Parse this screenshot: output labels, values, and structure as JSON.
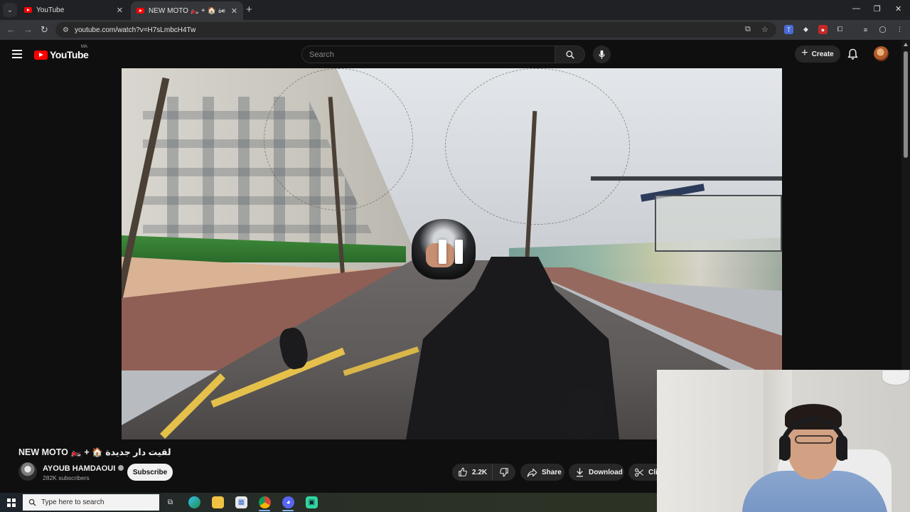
{
  "browser": {
    "tabs": [
      {
        "title": "YouTube",
        "active": false
      },
      {
        "title": "NEW MOTO 🏍️ + 🏠 لقيت دار جديدة",
        "active": true
      }
    ],
    "url": "youtube.com/watch?v=H7sLmbcH4Tw"
  },
  "masthead": {
    "logo_text": "YouTube",
    "region": "MA",
    "search_placeholder": "Search",
    "create_label": "Create"
  },
  "video": {
    "state": "paused-overlay"
  },
  "details": {
    "title": "NEW MOTO 🏍️ + 🏠 لقيت دار جديدة",
    "channel_name": "AYOUB HAMDAOUI",
    "subscribers": "282K subscribers",
    "subscribe_label": "Subscribe",
    "likes": "2.2K",
    "share_label": "Share",
    "download_label": "Download",
    "clip_label": "Clip"
  },
  "taskbar": {
    "search_placeholder": "Type here to search",
    "apps": [
      "task-view",
      "edge",
      "file-explorer",
      "store",
      "chrome",
      "discord",
      "app"
    ]
  },
  "colors": {
    "brand_red": "#ff0000",
    "page_bg": "#0f0f0f",
    "pill_bg": "#272727"
  }
}
